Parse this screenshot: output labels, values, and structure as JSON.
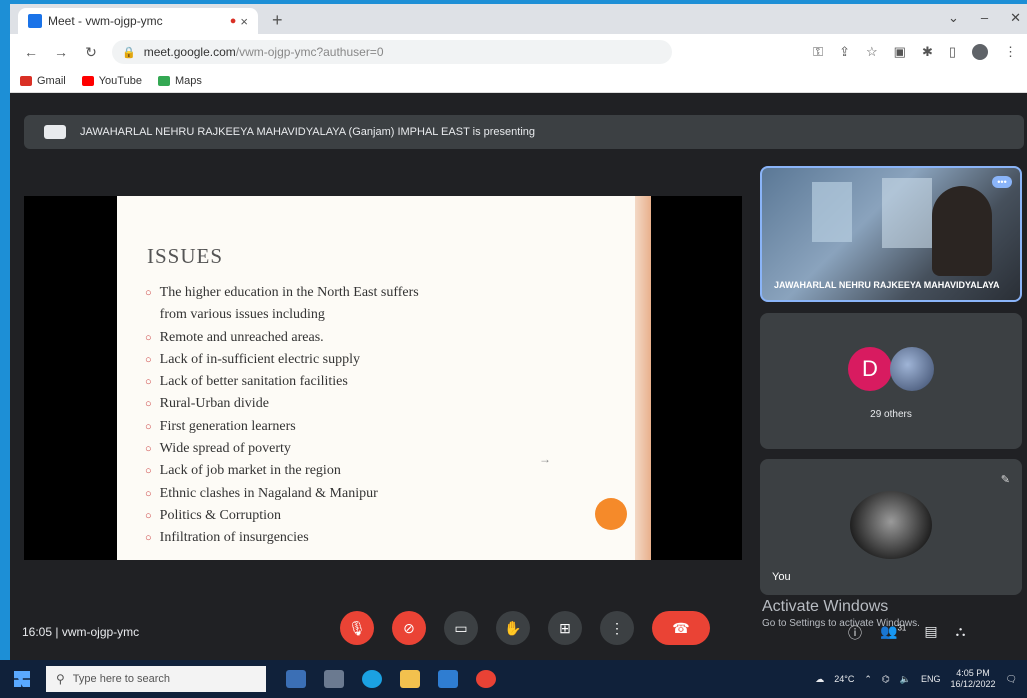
{
  "browser": {
    "tab_title": "Meet - vwm-ojgp-ymc",
    "recording_icon": "record-dot-icon",
    "url_host": "meet.google.com",
    "url_path": "/vwm-ojgp-ymc?authuser=0",
    "bookmarks": [
      {
        "label": "Gmail",
        "color": "#d93025"
      },
      {
        "label": "YouTube",
        "color": "#ff0000"
      },
      {
        "label": "Maps",
        "color": "#34a853"
      }
    ]
  },
  "meet": {
    "presenting_banner": "JAWAHARLAL NEHRU RAJKEEYA MAHAVIDYALAYA (Ganjam) IMPHAL EAST is presenting",
    "slide": {
      "title": "ISSUES",
      "bullets": [
        "The higher education in the North East suffers",
        "from various issues including",
        "Remote and unreached areas.",
        "Lack of in-sufficient electric supply",
        "Lack of better sanitation facilities",
        "Rural-Urban divide",
        "First generation learners",
        "Wide spread of poverty",
        "Lack of job market in the region",
        "Ethnic clashes in Nagaland & Manipur",
        "Politics & Corruption",
        "Infiltration of insurgencies"
      ]
    },
    "tiles": {
      "presenter_name": "JAWAHARLAL NEHRU RAJKEEYA MAHAVIDYALAYA",
      "others_initial": "D",
      "others_label": "29 others",
      "self_label": "You"
    },
    "meeting_time": "16:05",
    "meeting_code": "vwm-ojgp-ymc",
    "participant_count": "31",
    "activate_windows": {
      "title": "Activate Windows",
      "subtitle": "Go to Settings to activate Windows."
    }
  },
  "taskbar": {
    "search_placeholder": "Type here to search",
    "time": "4:05 PM",
    "date": "16/12/2022",
    "lang": "ENG",
    "weather": "24°C"
  },
  "colors": {
    "meet_bg": "#202124",
    "tile_bg": "#3c4043",
    "danger": "#ea4335",
    "accent": "#8ab4f8",
    "desktop": "#1d8fd6"
  }
}
